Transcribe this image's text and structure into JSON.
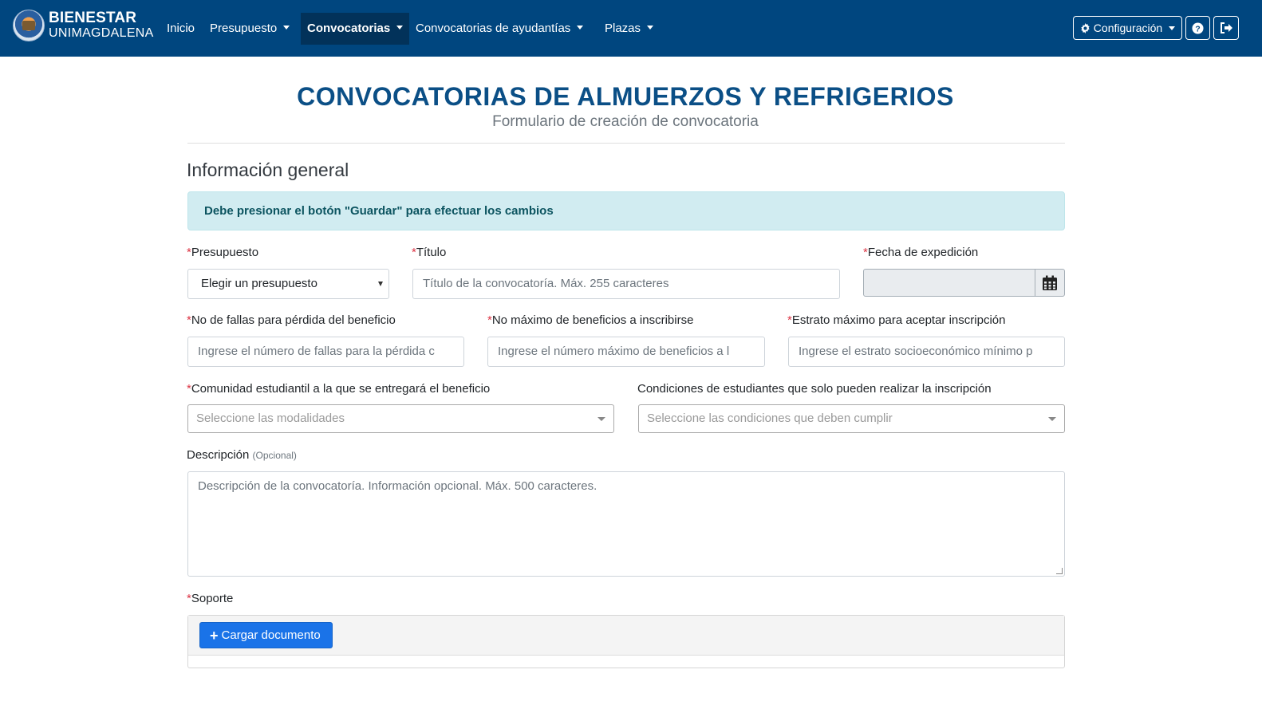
{
  "navbar": {
    "brand_title": "BIENESTAR",
    "brand_sub": "UNIMAGDALENA",
    "items": [
      {
        "label": "Inicio"
      },
      {
        "label": "Presupuesto"
      },
      {
        "label": "Convocatorias"
      },
      {
        "label": "Convocatorias de ayudantías"
      },
      {
        "label": "Plazas"
      }
    ],
    "config_label": "Configuración",
    "help_icon": "question-circle-icon",
    "logout_icon": "sign-out-icon",
    "bg_color": "#00467f"
  },
  "page": {
    "title": "CONVOCATORIAS DE ALMUERZOS Y REFRIGERIOS",
    "subtitle": "Formulario de creación de convocatoria",
    "section_title": "Información general",
    "alert": "Debe presionar el botón \"Guardar\" para efectuar los cambios"
  },
  "form": {
    "required_mark": "*",
    "presupuesto": {
      "label": "Presupuesto",
      "value": "Elegir un presupuesto"
    },
    "titulo": {
      "label": "Título",
      "placeholder": "Título de la convocatoría. Máx. 255 caracteres"
    },
    "fecha": {
      "label": "Fecha de expedición",
      "value": ""
    },
    "fallas": {
      "label": "No de fallas para pérdida del beneficio",
      "placeholder": "Ingrese el número de fallas para la pérdida c"
    },
    "maximo": {
      "label": "No máximo de beneficios a inscribirse",
      "placeholder": "Ingrese el número máximo de beneficios a l"
    },
    "estrato": {
      "label": "Estrato máximo para aceptar inscripción",
      "placeholder": "Ingrese el estrato socioeconómico mínimo p"
    },
    "comunidad": {
      "label": "Comunidad estudiantil a la que se entregará el beneficio",
      "placeholder": "Seleccione las modalidades"
    },
    "condiciones": {
      "label": "Condiciones de estudiantes que solo pueden realizar la inscripción",
      "placeholder": "Seleccione las condiciones que deben cumplir"
    },
    "descripcion": {
      "label": "Descripción",
      "optional": "(Opcional)",
      "placeholder": "Descripción de la convocatoría. Información opcional. Máx. 500 caracteres."
    },
    "soporte": {
      "label": "Soporte",
      "button": "Cargar documento"
    }
  }
}
